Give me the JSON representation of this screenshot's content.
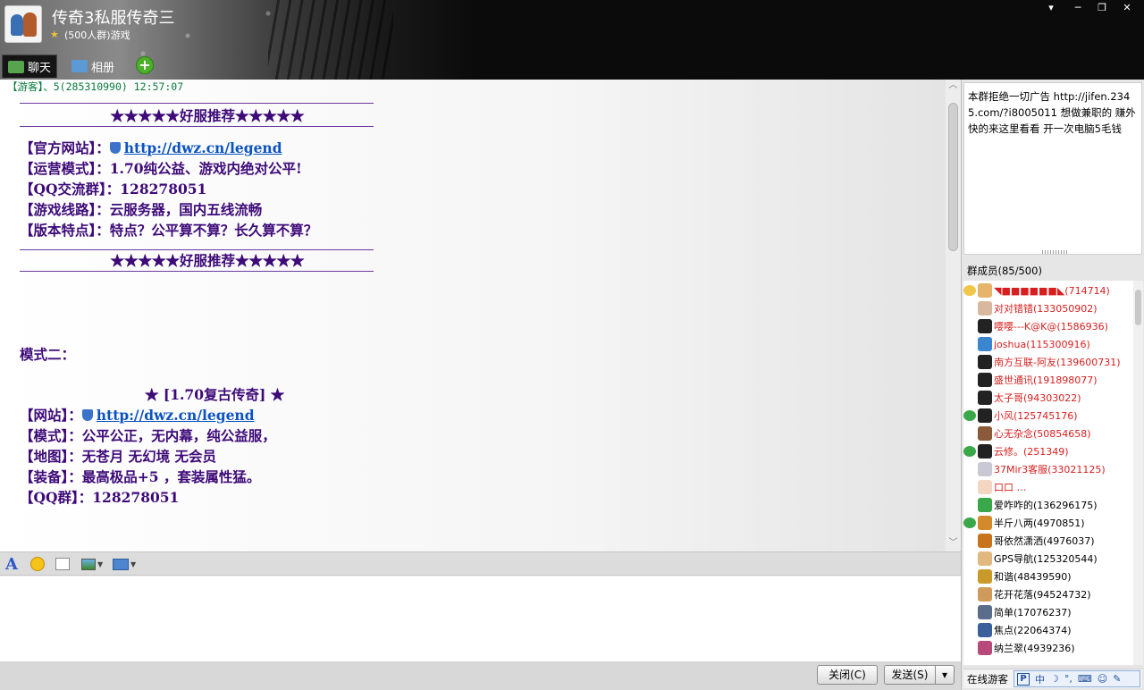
{
  "window": {
    "title": "传奇3私服传奇三",
    "subtitle": "(500人群)游戏",
    "controls": [
      "▾",
      "─",
      "❐",
      "✕"
    ]
  },
  "tabs": [
    {
      "label": "聊天",
      "icon": "chat-icon"
    },
    {
      "label": "相册",
      "icon": "album-icon"
    }
  ],
  "add_tab_label": "+",
  "chat": {
    "sender": "【游客】、5(285310990)  12:57:07",
    "banner": "★★★★★好服推荐★★★★★",
    "block1": [
      {
        "label": "【官方网站】：",
        "value": "http://dwz.cn/legend",
        "is_link": true
      },
      {
        "label": "【运营模式】：",
        "value": "1.70纯公益、游戏内绝对公平!"
      },
      {
        "label": "【QQ交流群】：",
        "value": "128278051"
      },
      {
        "label": "【游戏线路】：",
        "value": "云服务器，国内五线流畅"
      },
      {
        "label": "【版本特点】：",
        "value": "特点？公平算不算？长久算不算？"
      }
    ],
    "mode_title": "模式二：",
    "mode_heading": "★ [1.70复古传奇] ★",
    "block2": [
      {
        "label": "【网站】：",
        "value": "http://dwz.cn/legend",
        "is_link": true
      },
      {
        "label": "【模式】：",
        "value": "公平公正，无内幕，纯公益服，"
      },
      {
        "label": "【地图】：",
        "value": "无苍月 无幻境 无会员"
      },
      {
        "label": "【装备】：",
        "value": "最高极品+5 ，套装属性猛。"
      },
      {
        "label": "【QQ群】：",
        "value": "128278051"
      }
    ]
  },
  "toolbar": {
    "font_label": "A"
  },
  "buttons": {
    "close": "关闭(C)",
    "send": "发送(S)",
    "send_menu": "▾"
  },
  "notice": "本群拒绝一切广告 http://jifen.2345.com/?i8005011  想做兼职的 赚外快的来这里看看  开一次电脑5毛钱",
  "members_title": "群成员(85/500)",
  "members": [
    {
      "name": "◥■■■■■■◣(714714)",
      "color": "#d81e1e",
      "avatar": "#e5b36a",
      "side": "#f2c64b"
    },
    {
      "name": "对对错错(133050902)",
      "color": "#d81e1e",
      "avatar": "#d8b9a0"
    },
    {
      "name": "嘤嘤---K@K@(1586936)",
      "color": "#d81e1e",
      "avatar": "#222222"
    },
    {
      "name": "joshua(115300916)",
      "color": "#d81e1e",
      "avatar": "#3c86d0"
    },
    {
      "name": "南方互联-阿友(139600731)",
      "color": "#d81e1e",
      "avatar": "#222222"
    },
    {
      "name": "盛世通讯(191898077)",
      "color": "#d81e1e",
      "avatar": "#222222"
    },
    {
      "name": "太子哥(94303022)",
      "color": "#d81e1e",
      "avatar": "#222222"
    },
    {
      "name": "小风(125745176)",
      "color": "#d81e1e",
      "avatar": "#222222",
      "side": "#3aa84a"
    },
    {
      "name": "心无杂念(50854658)",
      "color": "#d81e1e",
      "avatar": "#8a5a3a"
    },
    {
      "name": "云修。(251349)",
      "color": "#d81e1e",
      "avatar": "#222222",
      "side": "#3aa84a"
    },
    {
      "name": "37Mir3客服(33021125)",
      "color": "#d81e1e",
      "avatar": "#c9c9d6"
    },
    {
      "name": "          口口        …",
      "color": "#d81e1e",
      "avatar": "#f3d7c3"
    },
    {
      "name": "爱咋咋的(136296175)",
      "color": "#000000",
      "avatar": "#3aa84a"
    },
    {
      "name": " 半斤八两(4970851)",
      "color": "#000000",
      "avatar": "#d28a2a",
      "side": "#3aa84a"
    },
    {
      "name": " 哥依然潇洒(4976037)",
      "color": "#000000",
      "avatar": "#c8741e"
    },
    {
      "name": "GPS导航(125320544)",
      "color": "#000000",
      "avatar": "#e1b87f"
    },
    {
      "name": "和谐(48439590)",
      "color": "#000000",
      "avatar": "#c99a2a"
    },
    {
      "name": "花开花落(94524732)",
      "color": "#000000",
      "avatar": "#d09a5a"
    },
    {
      "name": "简单(17076237)",
      "color": "#000000",
      "avatar": "#5a6d8a"
    },
    {
      "name": "焦点(22064374)",
      "color": "#000000",
      "avatar": "#3a5f9a"
    },
    {
      "name": "纳兰翠(4939236)",
      "color": "#000000",
      "avatar": "#b84a7a"
    }
  ],
  "online_label": "在线游客",
  "ime": {
    "logo": "P",
    "mode": "中"
  }
}
